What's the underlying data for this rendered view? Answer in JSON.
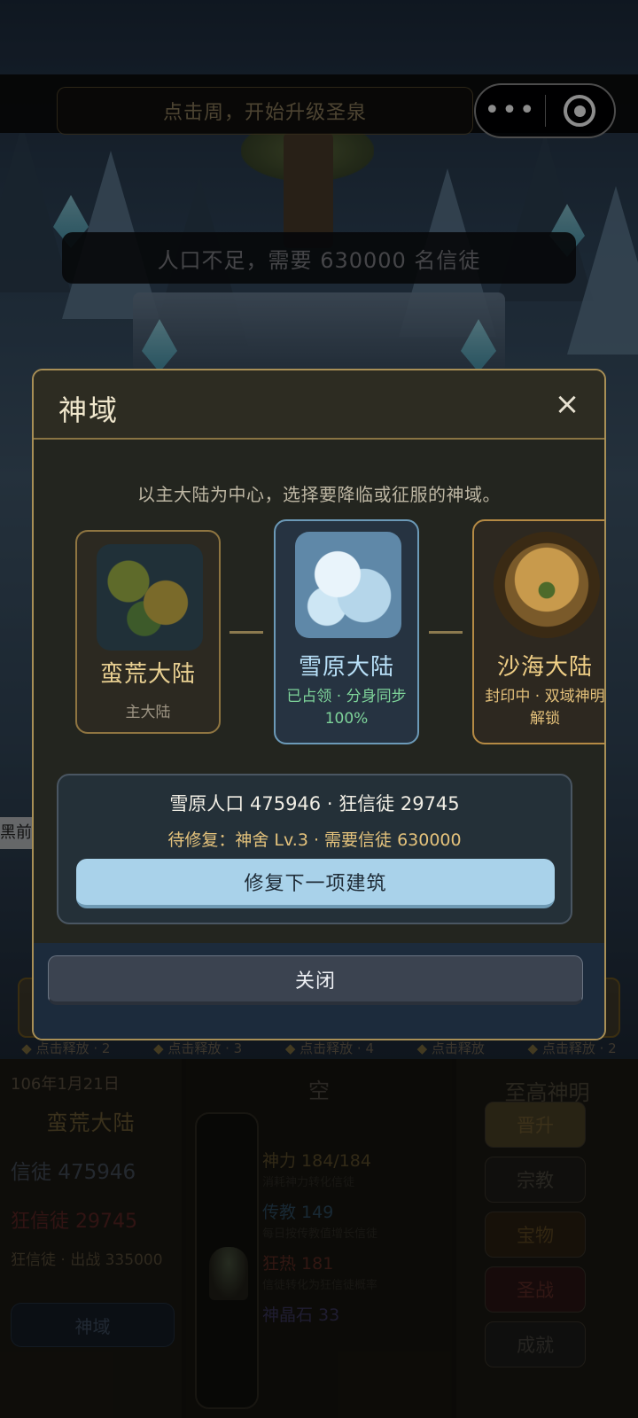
{
  "top_hint": "点击周，开始升级圣泉",
  "toast": "人口不足，需要 630000 名信徒",
  "side_label": "黑前",
  "release_labels": [
    "点击释放 · 2",
    "点击释放 · 3",
    "点击释放 · 4",
    "点击释放",
    "点击释放 · 2"
  ],
  "hud": {
    "date": "106年1月21日",
    "continent": "蛮荒大陆",
    "believers": "信徒 475946",
    "fanatics": "狂信徒 29745",
    "battle": "狂信徒 · 出战 335000",
    "realm_button": "神域",
    "mid_title": "空",
    "stats": [
      {
        "label": "神力 184/184",
        "desc": "消耗神力转化信徒",
        "color": "#5c4d2a"
      },
      {
        "label": "传教 149",
        "desc": "每日按传教值增长信徒",
        "color": "#2d4a5e"
      },
      {
        "label": "狂热 181",
        "desc": "信徒转化为狂信徒概率",
        "color": "#5a2a22"
      },
      {
        "label": "神晶石 33",
        "desc": "",
        "color": "#3a355a"
      }
    ],
    "right_title": "至高神明",
    "right_buttons": [
      {
        "label": "晋升",
        "bg": "#4a4026",
        "color": "#6d5a30"
      },
      {
        "label": "宗教",
        "bg": "#1e1d19",
        "color": "#4a463c"
      },
      {
        "label": "宝物",
        "bg": "#2a2012",
        "color": "#5c4520"
      },
      {
        "label": "圣战",
        "bg": "#2a1514",
        "color": "#5c2a26"
      },
      {
        "label": "成就",
        "bg": "#1c1c1a",
        "color": "#45433c"
      }
    ]
  },
  "modal": {
    "title": "神域",
    "close_symbol": "×",
    "intro": "以主大陆为中心，选择要降临或征服的神域。",
    "realms": [
      {
        "name": "蛮荒大陆",
        "sub": "主大陆"
      },
      {
        "name": "雪原大陆",
        "sub": "已占领 · 分身同步 100%"
      },
      {
        "name": "沙海大陆",
        "sub": "封印中 · 双域神明解锁"
      }
    ],
    "info_line1": "雪原人口 475946 · 狂信徒 29745",
    "info_line2": "待修复：神舍 Lv.3 · 需要信徒 630000",
    "repair_button": "修复下一项建筑",
    "close_button": "关闭"
  }
}
